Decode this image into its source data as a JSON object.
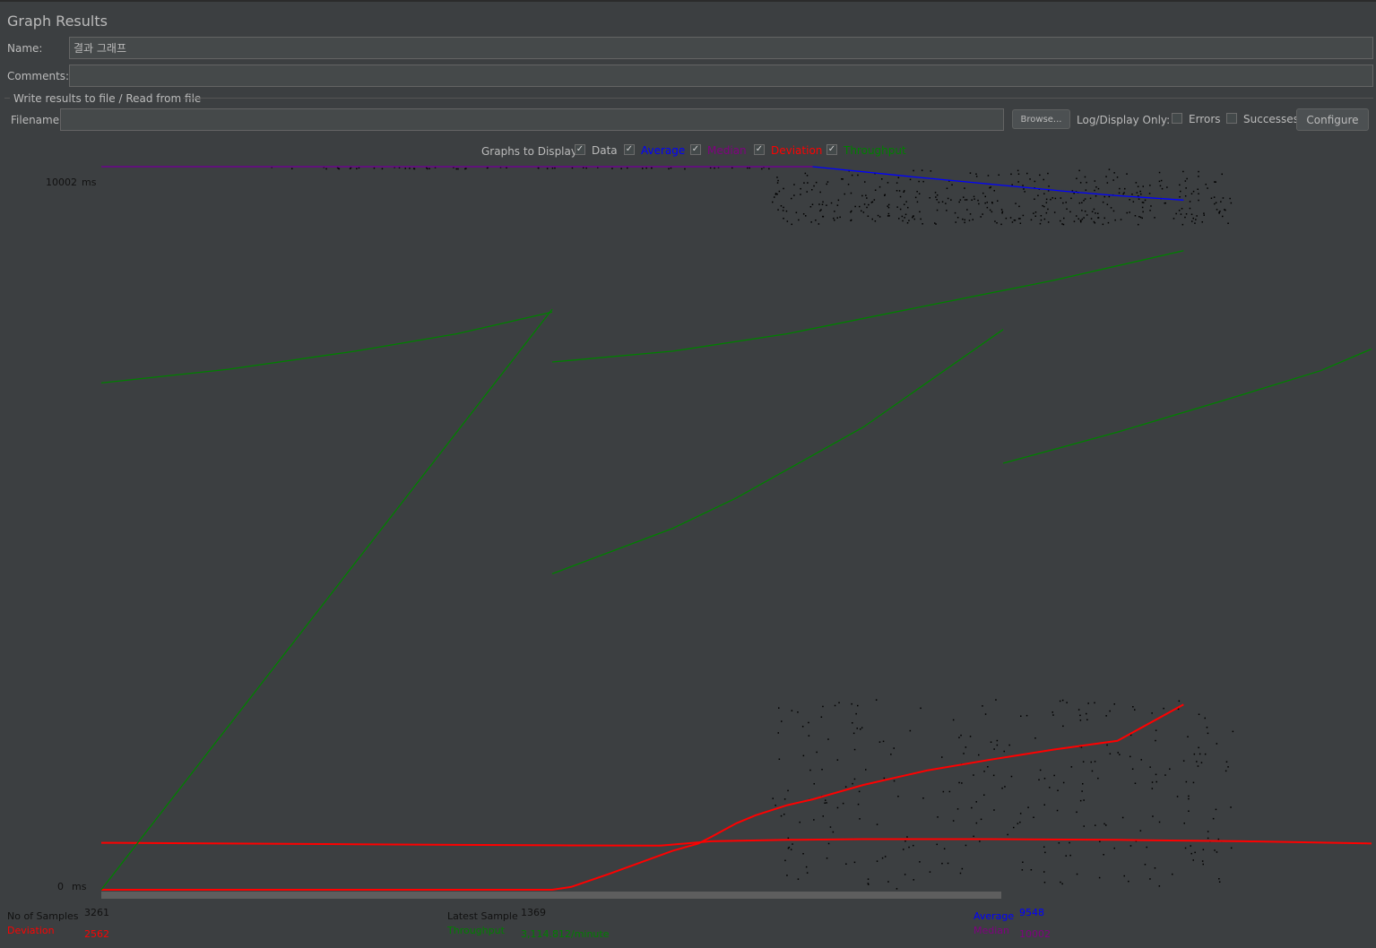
{
  "panel": {
    "title": "Graph Results"
  },
  "name": {
    "label": "Name:",
    "value": "결과 그래프"
  },
  "comments": {
    "label": "Comments:",
    "value": ""
  },
  "file_group": {
    "title": "Write results to file / Read from file",
    "filename_label": "Filename",
    "filename_value": "",
    "browse_label": "Browse...",
    "log_display_label": "Log/Display Only:",
    "errors_label": "Errors",
    "successes_label": "Successes",
    "configure_label": "Configure"
  },
  "graphs_to_display": {
    "label": "Graphs to Display",
    "items": [
      {
        "label": "Data",
        "checked": true,
        "color": "#bbbbbb"
      },
      {
        "label": "Average",
        "checked": true,
        "color": "#0000ff"
      },
      {
        "label": "Median",
        "checked": true,
        "color": "#800080"
      },
      {
        "label": "Deviation",
        "checked": true,
        "color": "#ff0000"
      },
      {
        "label": "Throughput",
        "checked": true,
        "color": "#008000"
      }
    ]
  },
  "axis": {
    "top_value": "10002",
    "bottom_value": "0",
    "unit": "ms"
  },
  "chart_data": {
    "type": "line",
    "ylim": [
      0,
      10002
    ],
    "xlim": [
      0,
      1000
    ],
    "series": [
      {
        "name": "Average",
        "color": "#0000ff",
        "points": [
          [
            0,
            10002
          ],
          [
            520,
            10002
          ],
          [
            560,
            10002
          ],
          [
            640,
            9860
          ],
          [
            700,
            9760
          ],
          [
            760,
            9660
          ],
          [
            800,
            9600
          ],
          [
            852,
            9540
          ]
        ]
      },
      {
        "name": "Median",
        "color": "#800080",
        "points": [
          [
            0,
            10002
          ],
          [
            520,
            10002
          ],
          [
            560,
            10002
          ]
        ]
      },
      {
        "name": "Deviation",
        "color": "#ff0000",
        "points": [
          [
            0,
            0
          ],
          [
            355,
            0
          ],
          [
            370,
            40
          ],
          [
            400,
            220
          ],
          [
            450,
            540
          ],
          [
            470,
            640
          ],
          [
            480,
            730
          ],
          [
            500,
            920
          ],
          [
            515,
            1030
          ],
          [
            540,
            1170
          ],
          [
            560,
            1250
          ],
          [
            600,
            1450
          ],
          [
            650,
            1650
          ],
          [
            700,
            1800
          ],
          [
            750,
            1940
          ],
          [
            800,
            2060
          ],
          [
            852,
            2562
          ]
        ]
      },
      {
        "name": "Deviation (2)",
        "color": "#ff0000",
        "points": [
          [
            0,
            650
          ],
          [
            100,
            640
          ],
          [
            200,
            630
          ],
          [
            300,
            620
          ],
          [
            360,
            615
          ],
          [
            440,
            610
          ],
          [
            480,
            670
          ],
          [
            540,
            690
          ],
          [
            600,
            700
          ],
          [
            700,
            700
          ],
          [
            800,
            690
          ],
          [
            900,
            670
          ],
          [
            1000,
            640
          ]
        ]
      },
      {
        "name": "Throughput (1)",
        "color": "#008000",
        "points": [
          [
            0,
            0
          ],
          [
            355,
            8030
          ]
        ]
      },
      {
        "name": "Throughput (2)",
        "color": "#008000",
        "points": [
          [
            0,
            7010
          ],
          [
            100,
            7200
          ],
          [
            200,
            7450
          ],
          [
            280,
            7690
          ],
          [
            355,
            7990
          ]
        ]
      },
      {
        "name": "Throughput (3)",
        "color": "#008000",
        "points": [
          [
            355,
            7300
          ],
          [
            450,
            7450
          ],
          [
            540,
            7690
          ],
          [
            650,
            8080
          ],
          [
            750,
            8430
          ],
          [
            852,
            8840
          ]
        ]
      },
      {
        "name": "Throughput (4)",
        "color": "#008000",
        "points": [
          [
            355,
            4370
          ],
          [
            450,
            5000
          ],
          [
            500,
            5420
          ],
          [
            600,
            6400
          ],
          [
            710,
            7750
          ]
        ]
      },
      {
        "name": "Throughput (5)",
        "color": "#008000",
        "points": [
          [
            710,
            5900
          ],
          [
            800,
            6330
          ],
          [
            880,
            6750
          ],
          [
            960,
            7180
          ],
          [
            1000,
            7480
          ]
        ]
      }
    ]
  },
  "stats": {
    "samples_label": "No of Samples",
    "samples_value": "3261",
    "latest_label": "Latest Sample",
    "latest_value": "1369",
    "average_label": "Average",
    "average_value": "9548",
    "deviation_label": "Deviation",
    "deviation_value": "2562",
    "throughput_label": "Throughput",
    "throughput_value": "3,114.812/minute",
    "median_label": "Median",
    "median_value": "10002"
  },
  "colors": {
    "average": "#0000ff",
    "median": "#800080",
    "deviation": "#ff0000",
    "throughput": "#008000",
    "data": "#000000",
    "background": "#3c3f41"
  }
}
